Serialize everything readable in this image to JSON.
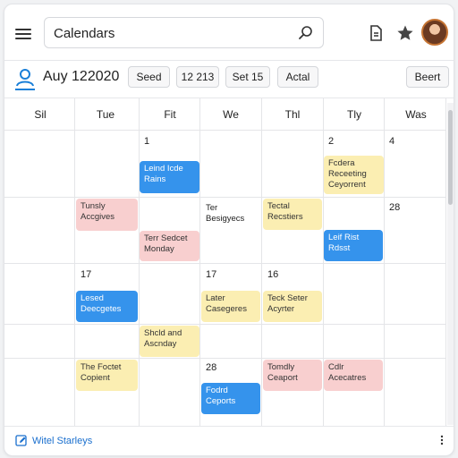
{
  "search": {
    "value": "Calendars"
  },
  "toolbar": {
    "date_title": "Auy 122020",
    "buttons": [
      "Seed",
      "12 213",
      "Set 15",
      "Actal"
    ],
    "right_button": "Beert"
  },
  "calendar": {
    "day_headers": [
      "Sil",
      "Tue",
      "Fit",
      "We",
      "Thl",
      "Tly",
      "Was"
    ],
    "day_numbers": [
      "1",
      "2",
      "4",
      "28",
      "17",
      "17",
      "16",
      "28"
    ],
    "events": [
      {
        "text": "Leind Icde\nRains",
        "color": "blue"
      },
      {
        "text": "Fcdera\nReceeting\nCeyorrent",
        "color": "yellow"
      },
      {
        "text": "Tunsly\nAccgives",
        "color": "red"
      },
      {
        "text": "Tectal\nRecstiers",
        "color": "yellow"
      },
      {
        "text": "Terr Sedcet\nMonday",
        "color": "red"
      },
      {
        "text": "Leif Rist\nRdsst",
        "color": "blue"
      },
      {
        "text": "Lesed\nDeecgetes",
        "color": "blue"
      },
      {
        "text": "Later\nCasegeres",
        "color": "yellow"
      },
      {
        "text": "Teck Seter\nAcyrter",
        "color": "yellow"
      },
      {
        "text": "Shcld and\nAscnday",
        "color": "yellow"
      },
      {
        "text": "The Foctet\nCopient",
        "color": "yellow"
      },
      {
        "text": "Fodrd\nCeports",
        "color": "blue"
      },
      {
        "text": "Tomdly\nCeaport",
        "color": "red"
      },
      {
        "text": "Cdlr\nAcecatres",
        "color": "red"
      }
    ],
    "plain_entry": "Ter\nBesigyecs"
  },
  "footer": {
    "text": "Witel Starleys"
  },
  "colors": {
    "event_blue": "#3593ec",
    "event_red": "#f8cfcf",
    "event_yellow": "#fbeeb2",
    "link": "#1a6fce"
  },
  "icons": [
    "menu-icon",
    "search-icon",
    "document-icon",
    "star-icon",
    "person-icon",
    "calendar-edit-icon",
    "more-vertical-icon"
  ]
}
